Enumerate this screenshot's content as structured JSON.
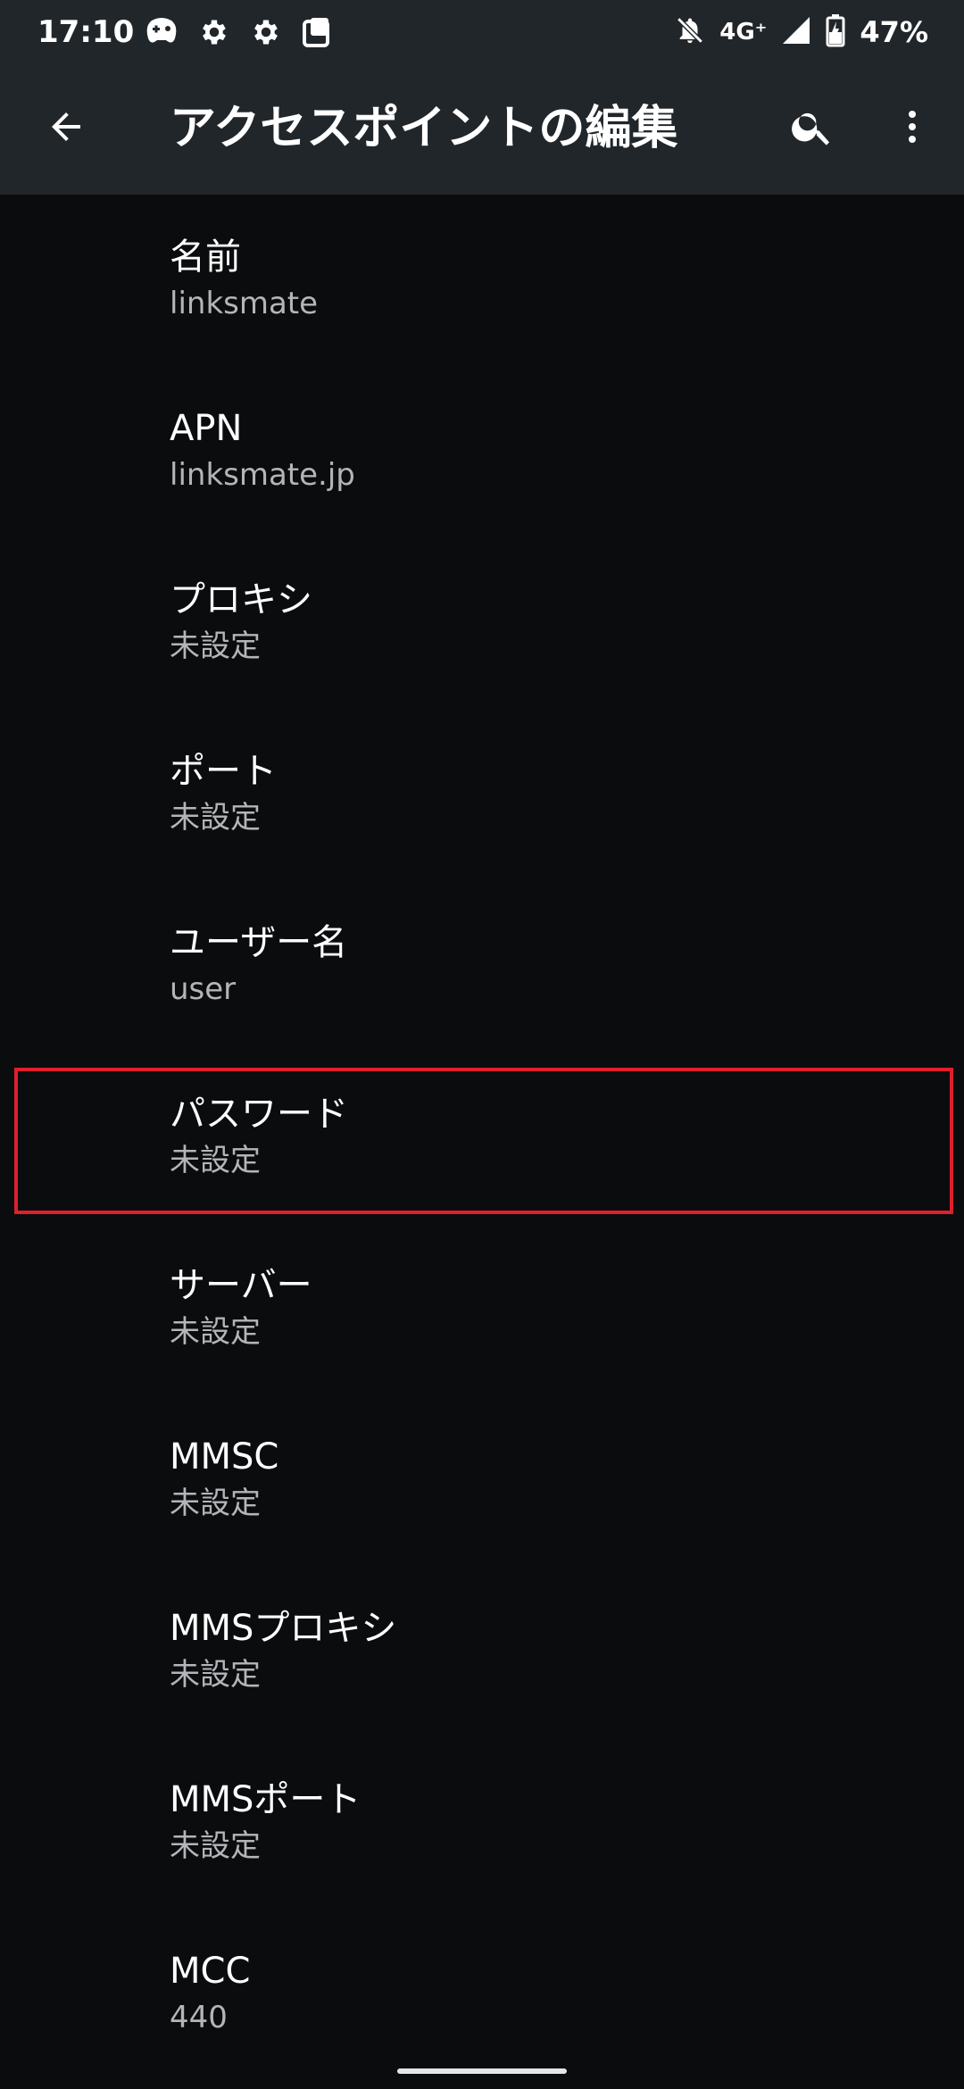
{
  "status_bar": {
    "time": "17:10",
    "left_icons": [
      "game-controller-icon",
      "gear-icon",
      "gear-icon",
      "notification-card-icon"
    ],
    "network": "4G⁺",
    "battery_percent": "47%",
    "notifications_muted": true
  },
  "app_bar": {
    "title": "アクセスポイントの編集",
    "back_icon": "arrow-back-icon",
    "search_icon": "search-icon",
    "more_icon": "more-vert-icon"
  },
  "preferences": [
    {
      "title": "名前",
      "summary": "linksmate"
    },
    {
      "title": "APN",
      "summary": "linksmate.jp"
    },
    {
      "title": "プロキシ",
      "summary": "未設定"
    },
    {
      "title": "ポート",
      "summary": "未設定"
    },
    {
      "title": "ユーザー名",
      "summary": "user"
    },
    {
      "title": "パスワード",
      "summary": "未設定"
    },
    {
      "title": "サーバー",
      "summary": "未設定"
    },
    {
      "title": "MMSC",
      "summary": "未設定"
    },
    {
      "title": "MMSプロキシ",
      "summary": "未設定"
    },
    {
      "title": "MMSポート",
      "summary": "未設定"
    },
    {
      "title": "MCC",
      "summary": "440"
    }
  ],
  "highlighted_item": "パスワード",
  "colors": {
    "background": "#0b0c0e",
    "app_bar": "#21262a",
    "summary_text": "#b3b5b8",
    "highlight": "#e01f2c"
  }
}
